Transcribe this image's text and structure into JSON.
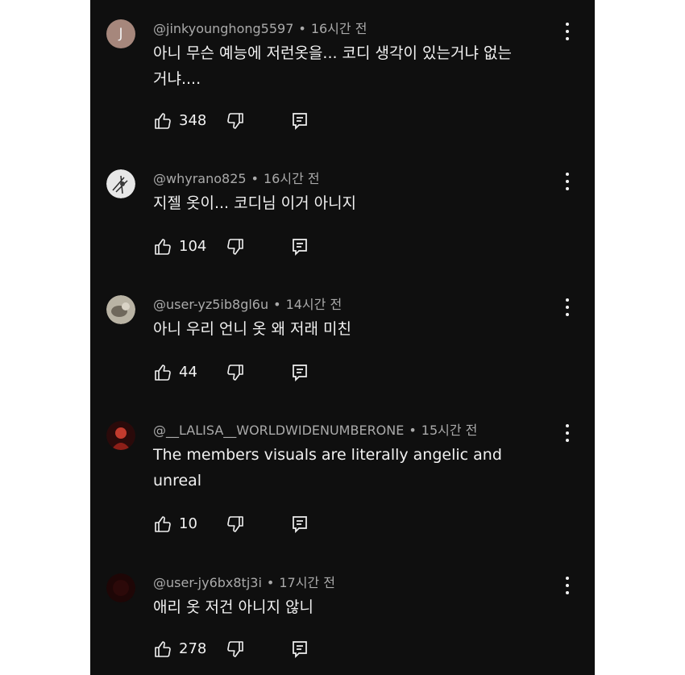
{
  "comments": [
    {
      "avatar_letter": "J",
      "username": "@jinkyounghong5597",
      "time": "16시간 전",
      "text": "아니 무슨 예능에 저런옷을... 코디 생각이 있는거냐 없는거냐....",
      "text_lines": [
        "아니 무슨 예능에 저런옷을... 코디 생각이 있는거냐 없는",
        "거냐...."
      ],
      "likes": "348"
    },
    {
      "username": "@whyrano825",
      "time": "16시간 전",
      "text": "지젤 옷이... 코디님 이거 아니지",
      "likes": "104"
    },
    {
      "username": "@user-yz5ib8gl6u",
      "time": "14시간 전",
      "text": "아니 우리 언니 옷 왜 저래 미친",
      "likes": "44"
    },
    {
      "username": "@__LALISA__WORLDWIDENUMBERONE",
      "time": "15시간 전",
      "text": "The members visuals are literally angelic and unreal",
      "text_lines": [
        "The members visuals are literally angelic and",
        "unreal"
      ],
      "likes": "10"
    },
    {
      "username": "@user-jy6bx8tj3i",
      "time": "17시간 전",
      "text": "애리 옷 저건 아니지 않니",
      "likes": "278"
    }
  ],
  "separator": "•",
  "icons": {
    "like": "thumbs-up-icon",
    "dislike": "thumbs-down-icon",
    "reply": "reply-icon",
    "more": "more-vertical-icon"
  },
  "colors": {
    "background": "#0f0f0f",
    "text_primary": "#f1f1f1",
    "text_secondary": "#aaaaaa",
    "avatar_j": "#a6877c"
  }
}
